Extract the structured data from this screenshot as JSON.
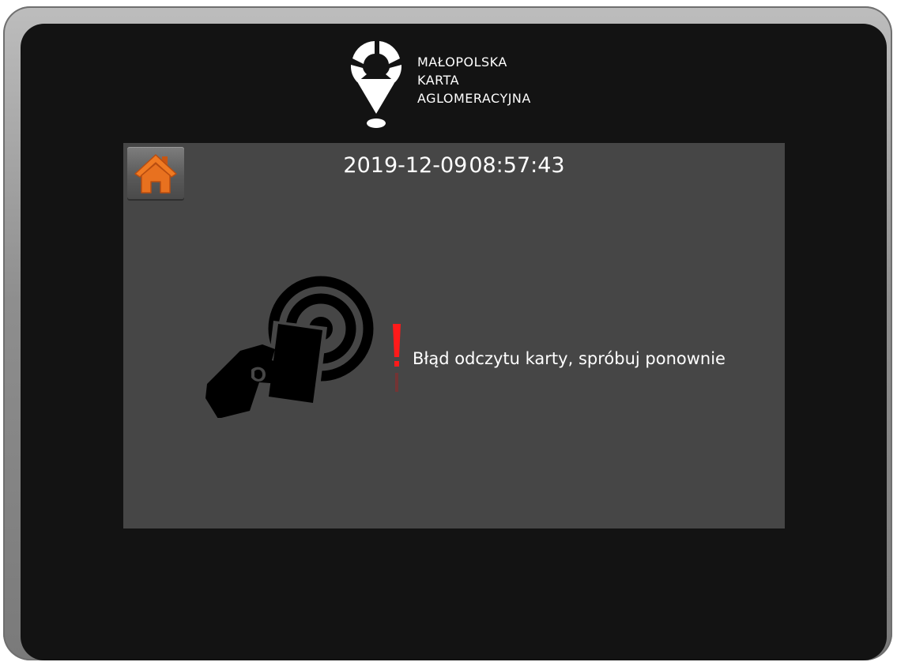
{
  "brand": {
    "logo_line1": "MAŁOPOLSKA",
    "logo_line2": "KARTA",
    "logo_line3": "AGLOMERACYJNA"
  },
  "header": {
    "date": "2019-12-09",
    "time": "08:57:43"
  },
  "home_button": {
    "icon": "home-icon",
    "color": "#e8711f"
  },
  "status": {
    "icon": "card-tap-icon",
    "alert_icon": "exclamation-icon",
    "alert_color": "#ff1a1a",
    "message": "Błąd odczytu karty, spróbuj ponownie"
  },
  "colors": {
    "bezel": "#131313",
    "panel": "#464646",
    "frame": "#9a9a9a"
  }
}
